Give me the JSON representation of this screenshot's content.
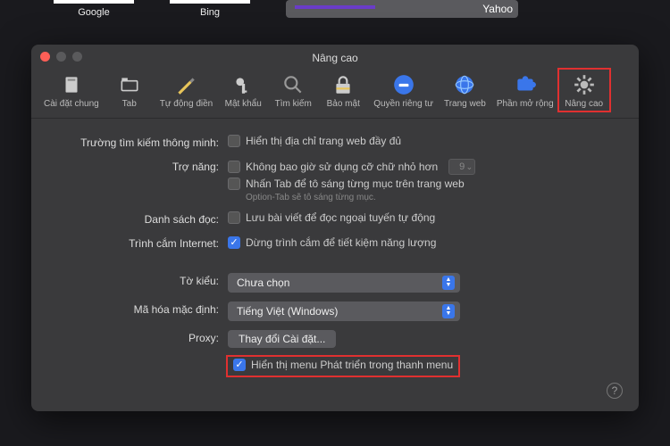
{
  "thumbs": [
    "Google",
    "Bing",
    "Yahoo"
  ],
  "window_title": "Nâng cao",
  "tabs": [
    {
      "label": "Cài đặt chung"
    },
    {
      "label": "Tab"
    },
    {
      "label": "Tự động điền"
    },
    {
      "label": "Mật khẩu"
    },
    {
      "label": "Tìm kiếm"
    },
    {
      "label": "Bảo mật"
    },
    {
      "label": "Quyền riêng tư"
    },
    {
      "label": "Trang web"
    },
    {
      "label": "Phần mở rộng"
    },
    {
      "label": "Nâng cao"
    }
  ],
  "labels": {
    "smart_search": "Trường tìm kiếm thông minh:",
    "accessibility": "Trợ năng:",
    "reading_list": "Danh sách đọc:",
    "internet_plugins": "Trình cắm Internet:",
    "stylesheet": "Tờ kiểu:",
    "default_encoding": "Mã hóa mặc định:",
    "proxy": "Proxy:"
  },
  "options": {
    "show_full_url": "Hiển thị địa chỉ trang web đầy đủ",
    "never_smaller": "Không bao giờ sử dụng cỡ chữ nhỏ hơn",
    "font_size": "9",
    "press_tab": "Nhấn Tab để tô sáng từng mục trên trang web",
    "option_tab_note": "Option-Tab sẽ tô sáng từng mục.",
    "save_offline": "Lưu bài viết để đọc ngoại tuyến tự động",
    "stop_plugins": "Dừng trình cắm để tiết kiệm năng lượng",
    "stylesheet_value": "Chưa chọn",
    "encoding_value": "Tiếng Việt (Windows)",
    "proxy_button": "Thay đổi Cài đặt...",
    "show_develop": "Hiển thị menu Phát triển trong thanh menu"
  }
}
